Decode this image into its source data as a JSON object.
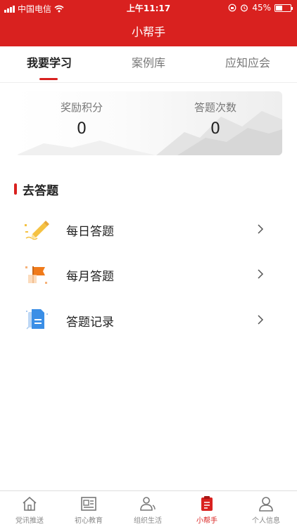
{
  "status_bar": {
    "carrier": "中国电信",
    "time": "上午11:17",
    "battery_percent": "45%",
    "battery_level": 0.45
  },
  "header": {
    "title": "小帮手",
    "background_color": "#d9211f"
  },
  "tabs": [
    {
      "label": "我要学习",
      "active": true
    },
    {
      "label": "案例库",
      "active": false
    },
    {
      "label": "应知应会",
      "active": false
    }
  ],
  "stats": [
    {
      "label": "奖励积分",
      "value": "0"
    },
    {
      "label": "答题次数",
      "value": "0"
    }
  ],
  "section": {
    "title": "去答题"
  },
  "menu": [
    {
      "label": "每日答题",
      "icon": "pencil-icon"
    },
    {
      "label": "每月答题",
      "icon": "flag-icon"
    },
    {
      "label": "答题记录",
      "icon": "document-icon"
    }
  ],
  "bottom_nav": [
    {
      "label": "党讯推送",
      "icon": "home-icon",
      "active": false
    },
    {
      "label": "初心教育",
      "icon": "id-card-icon",
      "active": false
    },
    {
      "label": "组织生活",
      "icon": "people-icon",
      "active": false
    },
    {
      "label": "小帮手",
      "icon": "clipboard-icon",
      "active": true
    },
    {
      "label": "个人信息",
      "icon": "user-icon",
      "active": false
    }
  ],
  "colors": {
    "accent": "#d9211f",
    "icon_yellow": "#f5c242",
    "icon_orange": "#f07a1a",
    "icon_blue": "#3a8ee6"
  }
}
